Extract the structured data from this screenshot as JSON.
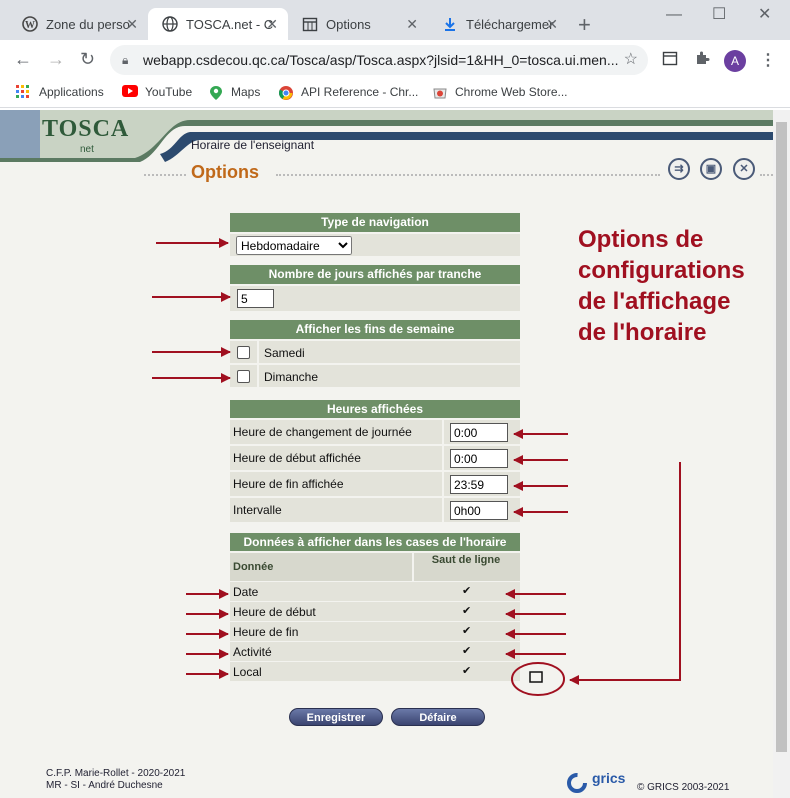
{
  "browser": {
    "tabs": [
      {
        "title": "Zone du perso",
        "icon": "wordpress-icon",
        "active": false
      },
      {
        "title": "TOSCA.net - C",
        "icon": "globe-icon",
        "active": true
      },
      {
        "title": "Options",
        "icon": "calendar-icon",
        "active": false
      },
      {
        "title": "Téléchargemen",
        "icon": "download-icon",
        "active": false
      }
    ],
    "new_tab": "+",
    "url": "webapp.csdecou.qc.ca/Tosca/asp/Tosca.aspx?jlsid=1&HH_0=tosca.ui.men...",
    "avatar_letter": "A",
    "bookmarks": [
      {
        "label": "Applications",
        "icon": "apps-grid-icon"
      },
      {
        "label": "YouTube",
        "icon": "youtube-icon"
      },
      {
        "label": "Maps",
        "icon": "maps-icon"
      },
      {
        "label": "API Reference - Chr...",
        "icon": "chrome-icon"
      },
      {
        "label": "Chrome Web Store...",
        "icon": "webstore-icon"
      }
    ]
  },
  "header": {
    "logo": "TOSCA",
    "logo_sub": "net",
    "breadcrumb": "Horaire de l'enseignant",
    "title": "Options"
  },
  "nav_type": {
    "heading": "Type de navigation",
    "selected": "Hebdomadaire"
  },
  "days_per_slice": {
    "heading": "Nombre de jours affichés par tranche",
    "value": "5"
  },
  "weekends": {
    "heading": "Afficher les fins de semaine",
    "items": [
      {
        "label": "Samedi",
        "checked": false
      },
      {
        "label": "Dimanche",
        "checked": false
      }
    ]
  },
  "hours": {
    "heading": "Heures affichées",
    "rows": [
      {
        "label": "Heure de changement de journée",
        "value": "0:00"
      },
      {
        "label": "Heure de début affichée",
        "value": "0:00"
      },
      {
        "label": "Heure de fin affichée",
        "value": "23:59"
      },
      {
        "label": "Intervalle",
        "value": "0h00"
      }
    ]
  },
  "data_display": {
    "heading": "Données à afficher dans les cases de l'horaire",
    "col_data": "Donnée",
    "col_break": "Saut de ligne",
    "rows": [
      {
        "label": "Date",
        "line_break": true
      },
      {
        "label": "Heure de début",
        "line_break": true
      },
      {
        "label": "Heure de fin",
        "line_break": true
      },
      {
        "label": "Activité",
        "line_break": true
      },
      {
        "label": "Local",
        "line_break": true
      }
    ],
    "check_glyph": "✔"
  },
  "buttons": {
    "save": "Enregistrer",
    "default": "Défaire"
  },
  "footer": {
    "line1": "C.F.P. Marie-Rollet - 2020-2021",
    "line2": "MR - SI - André Duchesne",
    "brand": "grics",
    "copyright": "© GRICS 2003-2021"
  },
  "annotation": {
    "lines": [
      "Options de",
      "configurations",
      "de l'affichage",
      "de l'horaire"
    ],
    "color": "#a01020"
  }
}
